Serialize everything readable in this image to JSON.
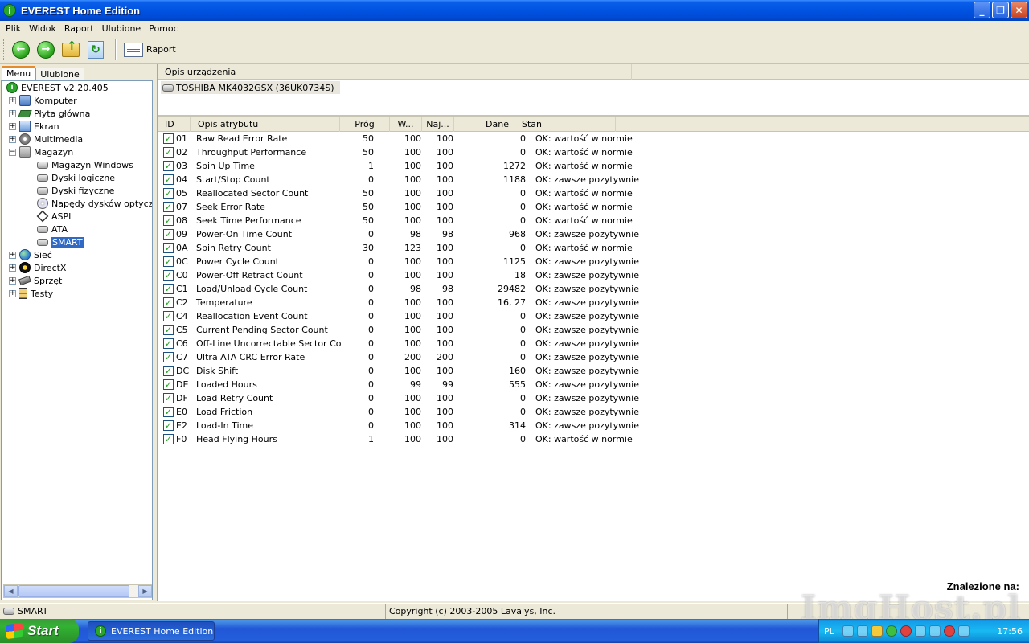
{
  "window": {
    "title": "EVEREST Home Edition",
    "icon_glyph": "i"
  },
  "menu": [
    "Plik",
    "Widok",
    "Raport",
    "Ulubione",
    "Pomoc"
  ],
  "toolbar": {
    "raport_label": "Raport"
  },
  "tabs": [
    "Menu",
    "Ulubione"
  ],
  "tree": [
    {
      "label": "EVEREST v2.20.405",
      "icon": "info-icon"
    },
    {
      "label": "Komputer",
      "icon": "computer-icon",
      "expander": "+"
    },
    {
      "label": "Płyta główna",
      "icon": "motherboard-icon",
      "expander": "+"
    },
    {
      "label": "Ekran",
      "icon": "monitor-icon",
      "expander": "+"
    },
    {
      "label": "Multimedia",
      "icon": "multimedia-icon",
      "expander": "+"
    },
    {
      "label": "Magazyn",
      "icon": "storage-icon",
      "expander": "−"
    },
    {
      "label": "Magazyn Windows",
      "icon": "disk-icon"
    },
    {
      "label": "Dyski logiczne",
      "icon": "disk-icon"
    },
    {
      "label": "Dyski fizyczne",
      "icon": "disk-icon"
    },
    {
      "label": "Napędy dysków optycznych",
      "icon": "cd-icon"
    },
    {
      "label": "ASPI",
      "icon": "aspi-icon"
    },
    {
      "label": "ATA",
      "icon": "disk-icon"
    },
    {
      "label": "SMART",
      "icon": "disk-icon",
      "selected": true
    },
    {
      "label": "Sieć",
      "icon": "network-icon",
      "expander": "+"
    },
    {
      "label": "DirectX",
      "icon": "directx-icon",
      "expander": "+"
    },
    {
      "label": "Sprzęt",
      "icon": "hardware-icon",
      "expander": "+"
    },
    {
      "label": "Testy",
      "icon": "hourglass-icon",
      "expander": "+"
    }
  ],
  "device_header": "Opis urządzenia",
  "device": "TOSHIBA MK4032GSX (36UK0734S)",
  "columns": {
    "id": "ID",
    "desc": "Opis atrybutu",
    "prog": "Próg",
    "w": "W...",
    "naj": "Naj...",
    "dane": "Dane",
    "stan": "Stan"
  },
  "rows": [
    {
      "id": "01",
      "desc": "Raw Read Error Rate",
      "prog": "50",
      "w": "100",
      "naj": "100",
      "dane": "0",
      "stan": "OK: wartość w normie"
    },
    {
      "id": "02",
      "desc": "Throughput Performance",
      "prog": "50",
      "w": "100",
      "naj": "100",
      "dane": "0",
      "stan": "OK: wartość w normie"
    },
    {
      "id": "03",
      "desc": "Spin Up Time",
      "prog": "1",
      "w": "100",
      "naj": "100",
      "dane": "1272",
      "stan": "OK: wartość w normie"
    },
    {
      "id": "04",
      "desc": "Start/Stop Count",
      "prog": "0",
      "w": "100",
      "naj": "100",
      "dane": "1188",
      "stan": "OK: zawsze pozytywnie"
    },
    {
      "id": "05",
      "desc": "Reallocated Sector Count",
      "prog": "50",
      "w": "100",
      "naj": "100",
      "dane": "0",
      "stan": "OK: wartość w normie"
    },
    {
      "id": "07",
      "desc": "Seek Error Rate",
      "prog": "50",
      "w": "100",
      "naj": "100",
      "dane": "0",
      "stan": "OK: wartość w normie"
    },
    {
      "id": "08",
      "desc": "Seek Time Performance",
      "prog": "50",
      "w": "100",
      "naj": "100",
      "dane": "0",
      "stan": "OK: wartość w normie"
    },
    {
      "id": "09",
      "desc": "Power-On Time Count",
      "prog": "0",
      "w": "98",
      "naj": "98",
      "dane": "968",
      "stan": "OK: zawsze pozytywnie"
    },
    {
      "id": "0A",
      "desc": "Spin Retry Count",
      "prog": "30",
      "w": "123",
      "naj": "100",
      "dane": "0",
      "stan": "OK: wartość w normie"
    },
    {
      "id": "0C",
      "desc": "Power Cycle Count",
      "prog": "0",
      "w": "100",
      "naj": "100",
      "dane": "1125",
      "stan": "OK: zawsze pozytywnie"
    },
    {
      "id": "C0",
      "desc": "Power-Off Retract Count",
      "prog": "0",
      "w": "100",
      "naj": "100",
      "dane": "18",
      "stan": "OK: zawsze pozytywnie"
    },
    {
      "id": "C1",
      "desc": "Load/Unload Cycle Count",
      "prog": "0",
      "w": "98",
      "naj": "98",
      "dane": "29482",
      "stan": "OK: zawsze pozytywnie"
    },
    {
      "id": "C2",
      "desc": "Temperature",
      "prog": "0",
      "w": "100",
      "naj": "100",
      "dane": "16, 27",
      "stan": "OK: zawsze pozytywnie"
    },
    {
      "id": "C4",
      "desc": "Reallocation Event Count",
      "prog": "0",
      "w": "100",
      "naj": "100",
      "dane": "0",
      "stan": "OK: zawsze pozytywnie"
    },
    {
      "id": "C5",
      "desc": "Current Pending Sector Count",
      "prog": "0",
      "w": "100",
      "naj": "100",
      "dane": "0",
      "stan": "OK: zawsze pozytywnie"
    },
    {
      "id": "C6",
      "desc": "Off-Line Uncorrectable Sector Count",
      "prog": "0",
      "w": "100",
      "naj": "100",
      "dane": "0",
      "stan": "OK: zawsze pozytywnie"
    },
    {
      "id": "C7",
      "desc": "Ultra ATA CRC Error Rate",
      "prog": "0",
      "w": "200",
      "naj": "200",
      "dane": "0",
      "stan": "OK: zawsze pozytywnie"
    },
    {
      "id": "DC",
      "desc": "Disk Shift",
      "prog": "0",
      "w": "100",
      "naj": "100",
      "dane": "160",
      "stan": "OK: zawsze pozytywnie"
    },
    {
      "id": "DE",
      "desc": "Loaded Hours",
      "prog": "0",
      "w": "99",
      "naj": "99",
      "dane": "555",
      "stan": "OK: zawsze pozytywnie"
    },
    {
      "id": "DF",
      "desc": "Load Retry Count",
      "prog": "0",
      "w": "100",
      "naj": "100",
      "dane": "0",
      "stan": "OK: zawsze pozytywnie"
    },
    {
      "id": "E0",
      "desc": "Load Friction",
      "prog": "0",
      "w": "100",
      "naj": "100",
      "dane": "0",
      "stan": "OK: zawsze pozytywnie"
    },
    {
      "id": "E2",
      "desc": "Load-In Time",
      "prog": "0",
      "w": "100",
      "naj": "100",
      "dane": "314",
      "stan": "OK: zawsze pozytywnie"
    },
    {
      "id": "F0",
      "desc": "Head Flying Hours",
      "prog": "1",
      "w": "100",
      "naj": "100",
      "dane": "0",
      "stan": "OK: wartość w normie"
    }
  ],
  "found_label": "Znalezione na:",
  "status": {
    "left": "SMART",
    "copyright": "Copyright (c) 2003-2005 Lavalys, Inc."
  },
  "watermark": "ImgHost.pl",
  "taskbar": {
    "start": "Start",
    "task": "EVEREST Home Edition",
    "lang": "PL",
    "clock": "17:56"
  }
}
